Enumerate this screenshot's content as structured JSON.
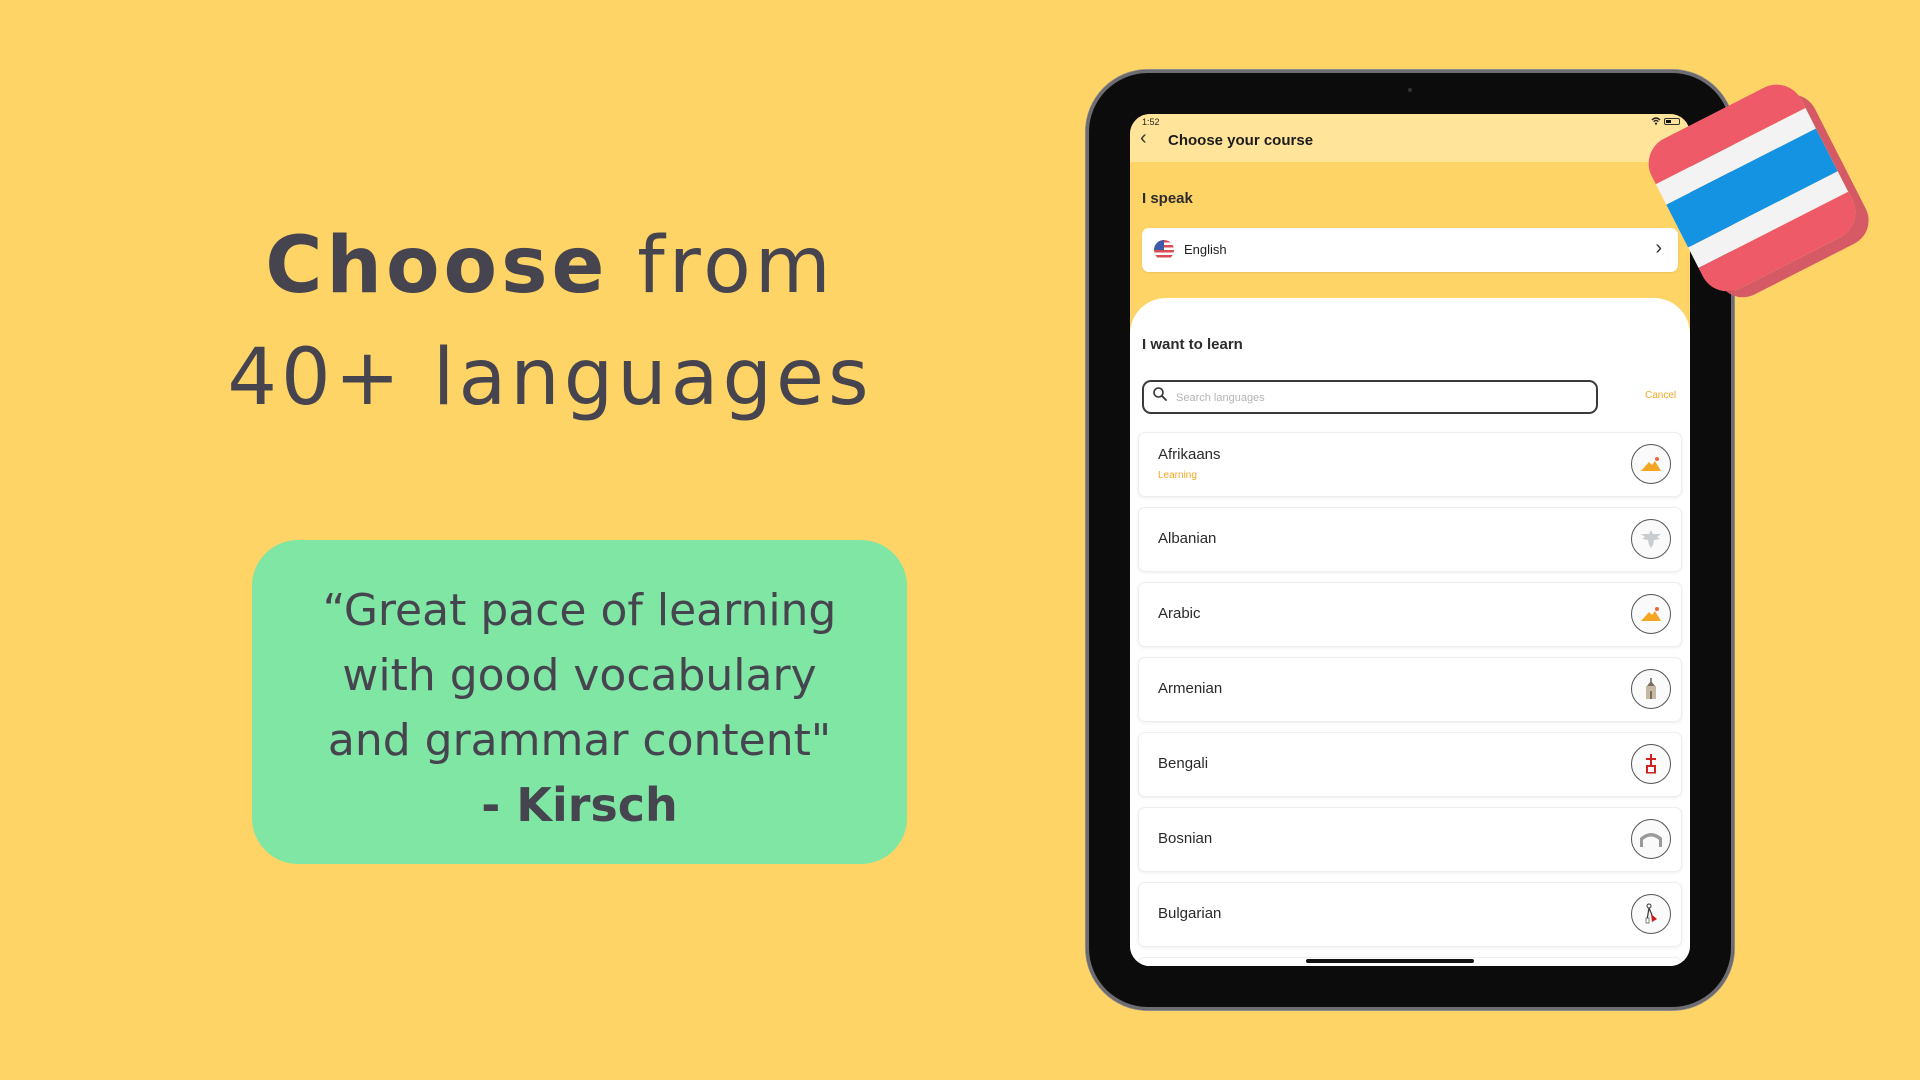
{
  "headline": {
    "bold": "Choose",
    "rest_line1": "from",
    "line2": "40+ languages"
  },
  "testimonial": {
    "quote_lines": [
      "“Great pace of learning",
      "with good vocabulary",
      "and grammar content\""
    ],
    "author": "- Kirsch"
  },
  "device": {
    "status_time": "1:52",
    "header": {
      "title": "Choose your course",
      "back_icon": "chevron-left-icon"
    },
    "speak": {
      "label": "I speak",
      "language": "English",
      "flag_icon": "us-flag-icon"
    },
    "learn": {
      "label": "I want to learn",
      "search_placeholder": "Search languages",
      "search_value": "",
      "cancel_label": "Cancel",
      "languages": [
        {
          "name": "Afrikaans",
          "status": "Learning",
          "icon": "mountain-sun-icon"
        },
        {
          "name": "Albanian",
          "status": "",
          "icon": "eagle-emblem-icon"
        },
        {
          "name": "Arabic",
          "status": "",
          "icon": "mountain-sun-icon"
        },
        {
          "name": "Armenian",
          "status": "",
          "icon": "church-icon"
        },
        {
          "name": "Bengali",
          "status": "",
          "icon": "bengali-glyph-icon"
        },
        {
          "name": "Bosnian",
          "status": "",
          "icon": "bridge-icon"
        },
        {
          "name": "Bulgarian",
          "status": "",
          "icon": "martenitsa-icon"
        }
      ]
    }
  },
  "decoration": {
    "flag_block": "thailand-flag",
    "colors": {
      "red": "#EF5A68",
      "white": "#F3F3F3",
      "blue": "#1493E2"
    }
  },
  "colors": {
    "background": "#FFD466",
    "quote_bg": "#7FE6A4",
    "accent": "#F6A623",
    "text": "#46444f"
  }
}
